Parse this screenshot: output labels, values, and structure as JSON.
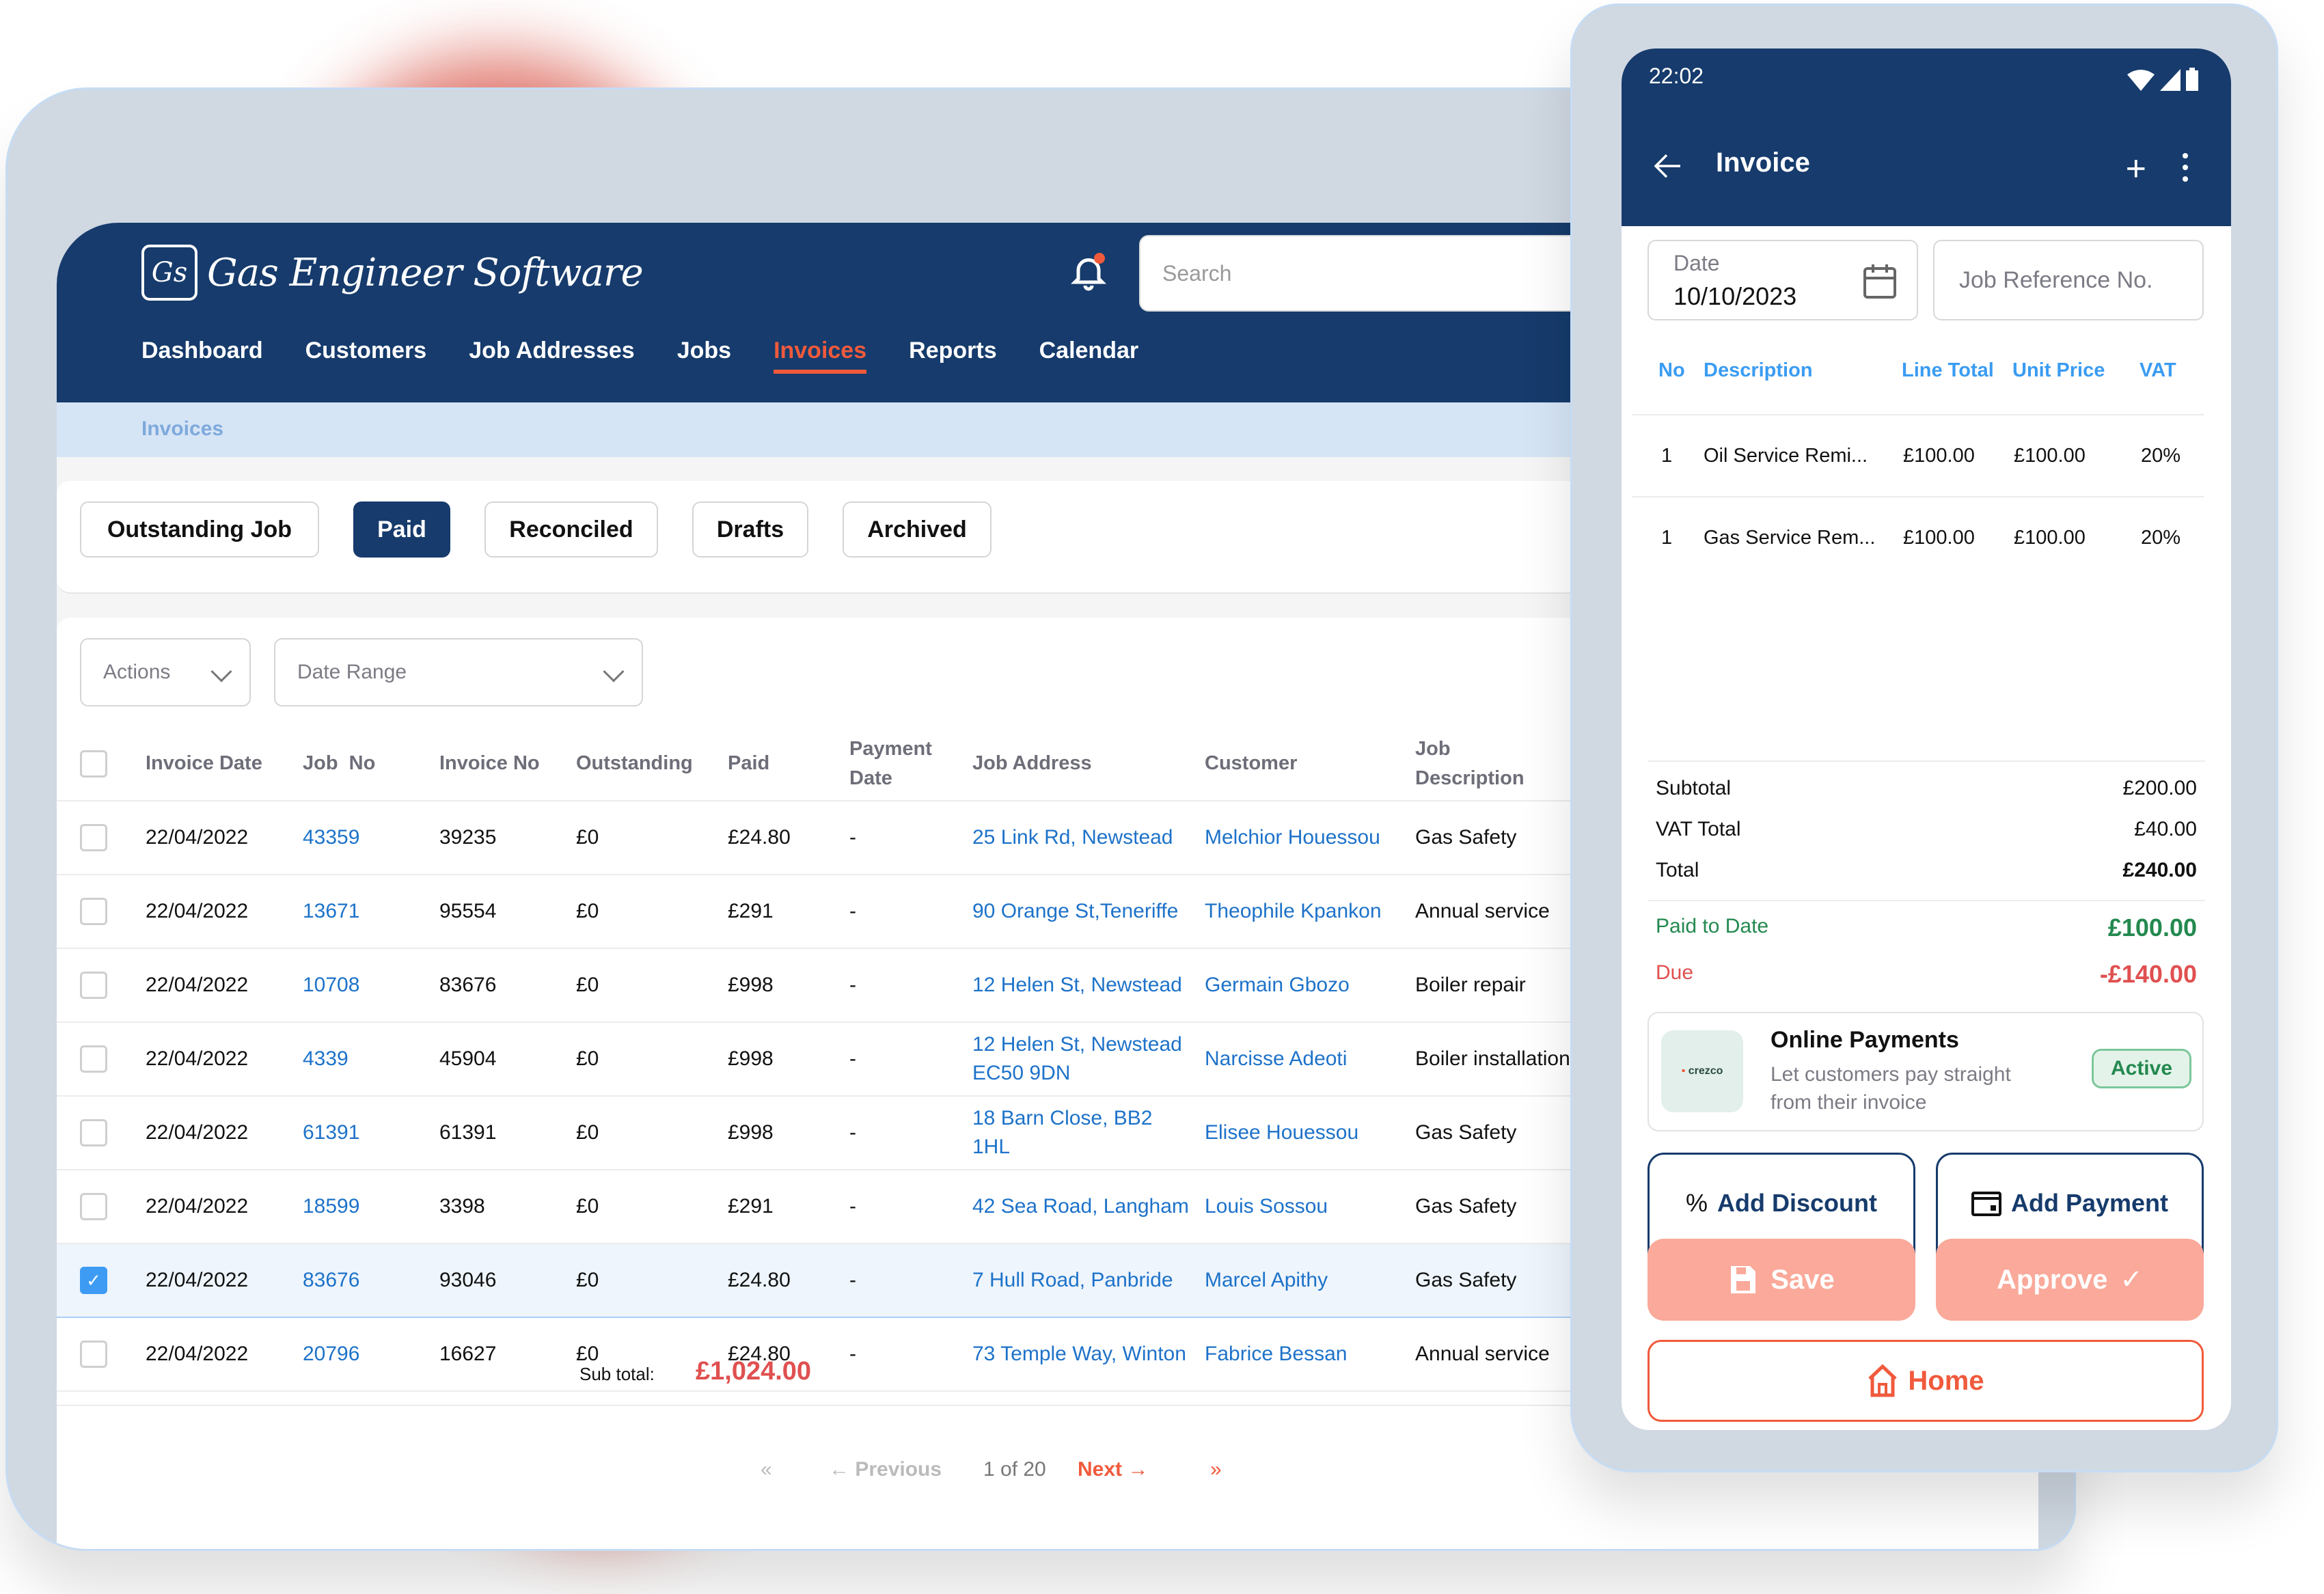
{
  "app": {
    "brand_mark": "Gs",
    "brand_name": "Gas Engineer Software",
    "search_placeholder": "Search",
    "nav": [
      {
        "label": "Dashboard",
        "active": false
      },
      {
        "label": "Customers",
        "active": false
      },
      {
        "label": "Job Addresses",
        "active": false
      },
      {
        "label": "Jobs",
        "active": false
      },
      {
        "label": "Invoices",
        "active": true
      },
      {
        "label": "Reports",
        "active": false
      },
      {
        "label": "Calendar",
        "active": false
      }
    ],
    "breadcrumb": "Invoices",
    "tabs": [
      {
        "label": "Outstanding Job",
        "active": false
      },
      {
        "label": "Paid",
        "active": true
      },
      {
        "label": "Reconciled",
        "active": false
      },
      {
        "label": "Drafts",
        "active": false
      },
      {
        "label": "Archived",
        "active": false
      }
    ],
    "filters": {
      "actions_label": "Actions",
      "date_range_label": "Date Range"
    },
    "table": {
      "columns": [
        "Invoice Date",
        "Job  No",
        "Invoice No",
        "Outstanding",
        "Paid",
        "Payment Date",
        "Job Address",
        "Customer",
        "Job Description"
      ],
      "rows": [
        {
          "checked": false,
          "invoice_date": "22/04/2022",
          "job_no": "43359",
          "invoice_no": "39235",
          "outstanding": "£0",
          "paid": "£24.80",
          "payment_date": "-",
          "job_address": "25 Link Rd, Newstead",
          "customer": "Melchior Houessou",
          "description": "Gas Safety"
        },
        {
          "checked": false,
          "invoice_date": "22/04/2022",
          "job_no": "13671",
          "invoice_no": "95554",
          "outstanding": "£0",
          "paid": "£291",
          "payment_date": "-",
          "job_address": "90 Orange St,Teneriffe",
          "customer": "Theophile Kpankon",
          "description": "Annual service"
        },
        {
          "checked": false,
          "invoice_date": "22/04/2022",
          "job_no": "10708",
          "invoice_no": "83676",
          "outstanding": "£0",
          "paid": "£998",
          "payment_date": "-",
          "job_address": "12 Helen St, Newstead",
          "customer": "Germain Gbozo",
          "description": "Boiler repair"
        },
        {
          "checked": false,
          "invoice_date": "22/04/2022",
          "job_no": "4339",
          "invoice_no": "45904",
          "outstanding": "£0",
          "paid": "£998",
          "payment_date": "-",
          "job_address": "12 Helen St, Newstead EC50 9DN",
          "customer": "Narcisse Adeoti",
          "description": "Boiler installation"
        },
        {
          "checked": false,
          "invoice_date": "22/04/2022",
          "job_no": "61391",
          "invoice_no": "61391",
          "outstanding": "£0",
          "paid": "£998",
          "payment_date": "-",
          "job_address": "18 Barn Close, BB2 1HL",
          "customer": "Elisee Houessou",
          "description": "Gas Safety"
        },
        {
          "checked": false,
          "invoice_date": "22/04/2022",
          "job_no": "18599",
          "invoice_no": "3398",
          "outstanding": "£0",
          "paid": "£291",
          "payment_date": "-",
          "job_address": "42 Sea Road, Langham",
          "customer": "Louis Sossou",
          "description": "Gas Safety"
        },
        {
          "checked": true,
          "invoice_date": "22/04/2022",
          "job_no": "83676",
          "invoice_no": "93046",
          "outstanding": "£0",
          "paid": "£24.80",
          "payment_date": "-",
          "job_address": "7 Hull Road, Panbride",
          "customer": "Marcel Apithy",
          "description": "Gas Safety"
        },
        {
          "checked": false,
          "invoice_date": "22/04/2022",
          "job_no": "20796",
          "invoice_no": "16627",
          "outstanding": "£0",
          "paid": "£24.80",
          "payment_date": "-",
          "job_address": "73 Temple Way, Winton",
          "customer": "Fabrice Bessan",
          "description": "Annual service"
        }
      ]
    },
    "subtotal_label": "Sub total:",
    "subtotal_value": "£1,024.00",
    "pagination": {
      "first": "«",
      "previous": "Previous",
      "page_info": "1 of 20",
      "next": "Next",
      "last": "»"
    }
  },
  "mobile": {
    "status_time": "22:02",
    "title": "Invoice",
    "date_label": "Date",
    "date_value": "10/10/2023",
    "job_ref_placeholder": "Job Reference No.",
    "line_items": {
      "columns": [
        "No",
        "Description",
        "Line Total",
        "Unit Price",
        "VAT"
      ],
      "rows": [
        {
          "no": "1",
          "description": "Oil Service Remi...",
          "line_total": "£100.00",
          "unit_price": "£100.00",
          "vat": "20%"
        },
        {
          "no": "1",
          "description": "Gas Service Rem...",
          "line_total": "£100.00",
          "unit_price": "£100.00",
          "vat": "20%"
        }
      ]
    },
    "totals": {
      "subtotal_label": "Subtotal",
      "subtotal": "£200.00",
      "vat_label": "VAT Total",
      "vat": "£40.00",
      "total_label": "Total",
      "total": "£240.00",
      "paid_label": "Paid to Date",
      "paid": "£100.00",
      "due_label": "Due",
      "due": "-£140.00"
    },
    "online_payments": {
      "provider": "crezco",
      "title": "Online Payments",
      "description": "Let customers pay straight from their invoice",
      "status": "Active"
    },
    "buttons": {
      "add_discount": "Add Discount",
      "add_payment": "Add Payment",
      "save": "Save",
      "approve": "Approve",
      "home": "Home"
    }
  },
  "colors": {
    "brand_navy": "#163b6c",
    "accent_orange": "#f05a3c",
    "link_blue": "#1d72c9",
    "paid_green": "#23894f",
    "due_red": "#e05050",
    "button_salmon": "#faa99a"
  }
}
